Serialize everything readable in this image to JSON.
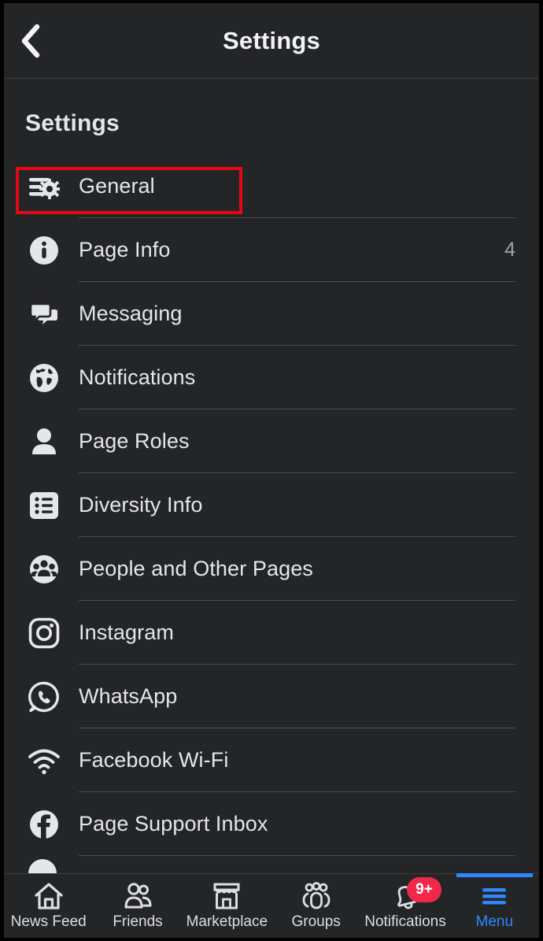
{
  "header": {
    "title": "Settings",
    "back_icon": "chevron-left-icon"
  },
  "page": {
    "title": "Settings"
  },
  "colors": {
    "background": "#242526",
    "text": "#e4e6eb",
    "divider": "#4a4b4d",
    "accent": "#2e89ff",
    "badge": "#f02849",
    "highlight": "#e50914"
  },
  "settings_list": [
    {
      "label": "General",
      "icon": "sliders-gear-icon",
      "value": "",
      "highlighted": true
    },
    {
      "label": "Page Info",
      "icon": "info-circle-icon",
      "value": "4",
      "highlighted": false
    },
    {
      "label": "Messaging",
      "icon": "chat-bubbles-icon",
      "value": "",
      "highlighted": false
    },
    {
      "label": "Notifications",
      "icon": "globe-icon",
      "value": "",
      "highlighted": false
    },
    {
      "label": "Page Roles",
      "icon": "person-icon",
      "value": "",
      "highlighted": false
    },
    {
      "label": "Diversity Info",
      "icon": "list-icon",
      "value": "",
      "highlighted": false
    },
    {
      "label": "People and Other Pages",
      "icon": "people-group-icon",
      "value": "",
      "highlighted": false
    },
    {
      "label": "Instagram",
      "icon": "instagram-icon",
      "value": "",
      "highlighted": false
    },
    {
      "label": "WhatsApp",
      "icon": "whatsapp-icon",
      "value": "",
      "highlighted": false
    },
    {
      "label": "Facebook Wi-Fi",
      "icon": "wifi-icon",
      "value": "",
      "highlighted": false
    },
    {
      "label": "Page Support Inbox",
      "icon": "facebook-icon",
      "value": "",
      "highlighted": false
    }
  ],
  "bottom_nav": [
    {
      "label": "News Feed",
      "icon": "home-icon",
      "active": false,
      "badge": ""
    },
    {
      "label": "Friends",
      "icon": "friends-icon",
      "active": false,
      "badge": ""
    },
    {
      "label": "Marketplace",
      "icon": "storefront-icon",
      "active": false,
      "badge": ""
    },
    {
      "label": "Groups",
      "icon": "groups-icon",
      "active": false,
      "badge": ""
    },
    {
      "label": "Notifications",
      "icon": "bell-icon",
      "active": false,
      "badge": "9+"
    },
    {
      "label": "Menu",
      "icon": "hamburger-menu-icon",
      "active": true,
      "badge": ""
    }
  ]
}
